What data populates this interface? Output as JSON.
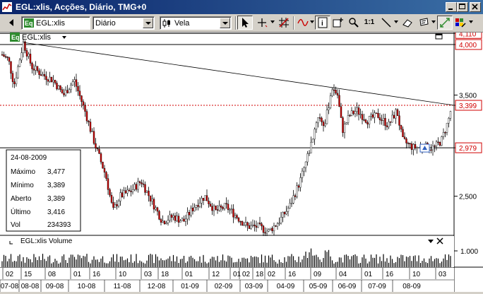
{
  "window": {
    "title": "EGL:xlis, Acções, Diário, TMG+0"
  },
  "toolbar": {
    "symbol_value": "EGL:xlis",
    "period_value": "Diário",
    "chart_type_value": "Vela",
    "zoom_label": "1:1"
  },
  "chart": {
    "label": "EGL:xlis",
    "price_labels": [
      "4,110",
      "4,000",
      "3,500",
      "3,399",
      "2,979",
      "2,500"
    ],
    "price_values": [
      4.11,
      4.0,
      3.5,
      3.399,
      2.979,
      2.5
    ],
    "highlight_color": "#d00000",
    "up_color": "#ffffff",
    "down_color": "#cc0000"
  },
  "infobox": {
    "date": "24-08-2009",
    "rows": [
      {
        "label": "Máximo",
        "value": "3,477"
      },
      {
        "label": "Mínimo",
        "value": "3,389"
      },
      {
        "label": "Aberto",
        "value": "3,389"
      },
      {
        "label": "Último",
        "value": "3,416"
      },
      {
        "label": "Vol",
        "value": "234393"
      }
    ]
  },
  "volume": {
    "label": "EGL:xlis Volume",
    "scale_label": "1.000"
  },
  "axis": {
    "days": [
      "02",
      "15",
      "08",
      "01",
      "16",
      "10",
      "03",
      "18",
      "01",
      "12",
      "01",
      "02",
      "18",
      "02",
      "16",
      "09",
      "04",
      "01",
      "16",
      "10",
      "03"
    ],
    "months": [
      "07-08",
      "08-08",
      "09-08",
      "10-08",
      "11-08",
      "12-08",
      "01-09",
      "02-09",
      "03-09",
      "04-09",
      "05-09",
      "06-09",
      "07-09",
      "08-09"
    ]
  }
}
